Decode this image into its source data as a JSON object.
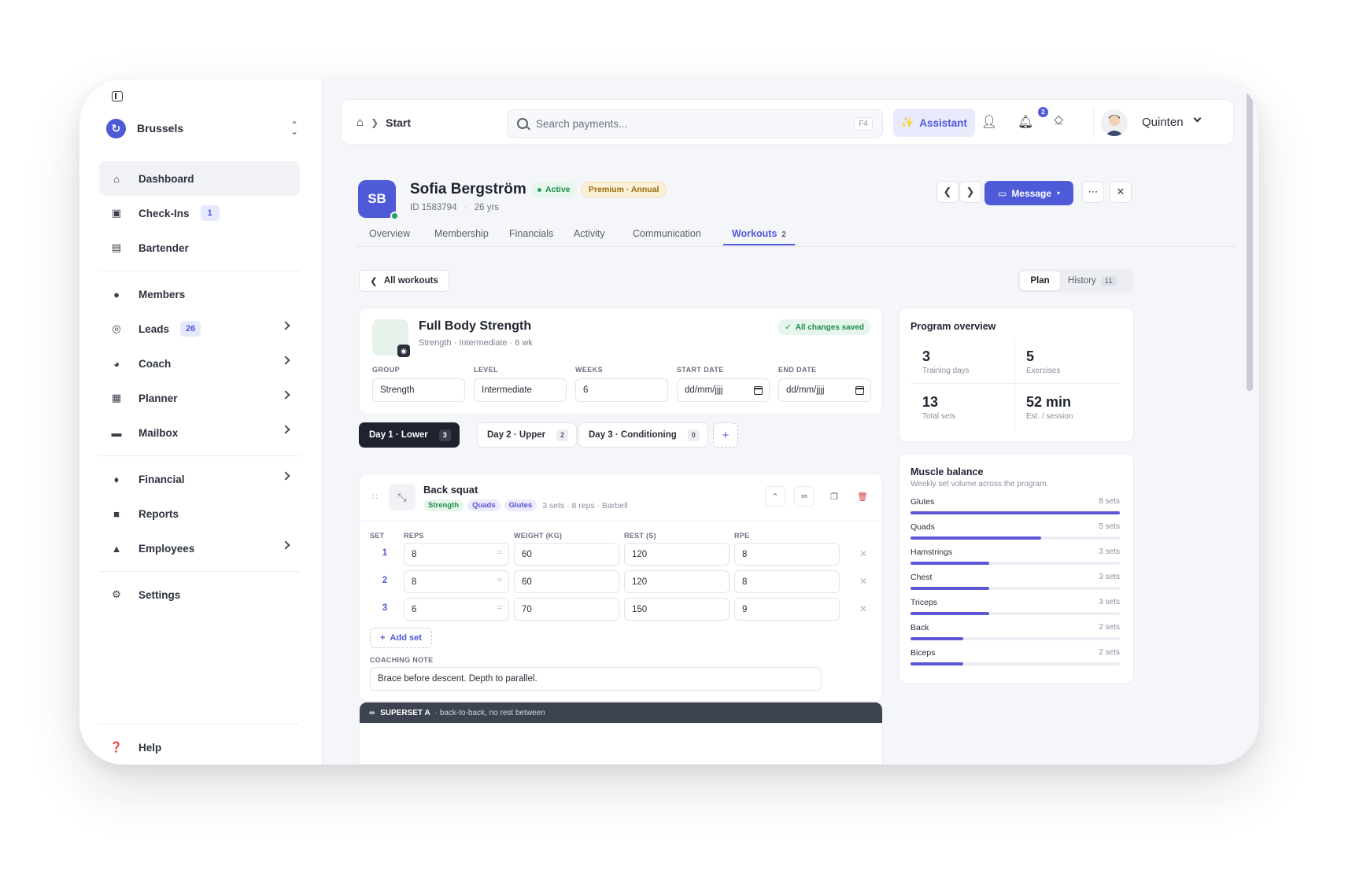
{
  "sidebar": {
    "org_name": "Brussels",
    "items": [
      {
        "label": "Dashboard",
        "icon": "home-icon"
      },
      {
        "label": "Check-Ins",
        "icon": "checkin-icon",
        "badge": "1"
      },
      {
        "label": "Bartender",
        "icon": "bartender-icon"
      },
      {
        "label": "Members",
        "icon": "members-icon"
      },
      {
        "label": "Leads",
        "icon": "leads-icon",
        "badge": "26"
      },
      {
        "label": "Coach",
        "icon": "coach-icon"
      },
      {
        "label": "Planner",
        "icon": "planner-icon"
      },
      {
        "label": "Mailbox",
        "icon": "mailbox-icon"
      },
      {
        "label": "Financial",
        "icon": "financial-icon"
      },
      {
        "label": "Reports",
        "icon": "reports-icon"
      },
      {
        "label": "Employees",
        "icon": "employees-icon"
      },
      {
        "label": "Settings",
        "icon": "gear-icon"
      },
      {
        "label": "Help",
        "icon": "help-icon"
      }
    ]
  },
  "topbar": {
    "breadcrumb": "Start",
    "search_placeholder": "Search payments...",
    "search_shortcut": "F4",
    "assistant_label": "Assistant",
    "notification_count": "2",
    "user_name": "Quinten"
  },
  "member": {
    "initials": "SB",
    "name": "Sofia Bergström",
    "status": "Active",
    "plan": "Premium · Annual",
    "id_text": "ID 1583794",
    "age": "26 yrs",
    "message_label": "Message"
  },
  "tabs": [
    {
      "label": "Overview"
    },
    {
      "label": "Membership"
    },
    {
      "label": "Financials"
    },
    {
      "label": "Activity"
    },
    {
      "label": "Communication"
    },
    {
      "label": "Workouts",
      "count": "2"
    }
  ],
  "workouts": {
    "back_label": "All workouts",
    "plan_label": "Plan",
    "history_label": "History",
    "history_count": "11"
  },
  "program": {
    "title": "Full Body Strength",
    "subtitle": "Strength · Intermediate · 6 wk",
    "saved_label": "All changes saved",
    "fields": {
      "group_label": "GROUP",
      "group_value": "Strength",
      "level_label": "LEVEL",
      "level_value": "Intermediate",
      "weeks_label": "WEEKS",
      "weeks_value": "6",
      "start_label": "START DATE",
      "start_value": "dd/mm/jjjj",
      "end_label": "END DATE",
      "end_value": "dd/mm/jjjj"
    }
  },
  "days": [
    {
      "label": "Day 1 · Lower",
      "count": "3"
    },
    {
      "label": "Day 2 · Upper",
      "count": "2"
    },
    {
      "label": "Day 3 · Conditioning",
      "count": "0"
    }
  ],
  "exercise": {
    "name": "Back squat",
    "tags": [
      "Strength",
      "Quads",
      "Glutes"
    ],
    "meta": "3 sets · 8 reps · Barbell",
    "headers": {
      "set": "SET",
      "reps": "REPS",
      "weight": "WEIGHT (KG)",
      "rest": "REST (S)",
      "rpe": "RPE"
    },
    "sets": [
      {
        "n": "1",
        "reps": "8",
        "weight": "60",
        "rest": "120",
        "rpe": "8"
      },
      {
        "n": "2",
        "reps": "8",
        "weight": "60",
        "rest": "120",
        "rpe": "8"
      },
      {
        "n": "3",
        "reps": "6",
        "weight": "70",
        "rest": "150",
        "rpe": "9"
      }
    ],
    "add_set_label": "Add set",
    "note_label": "COACHING NOTE",
    "note_value": "Brace before descent. Depth to parallel."
  },
  "superset": {
    "title": "SUPERSET A",
    "subtitle": "· back-to-back, no rest between"
  },
  "overview": {
    "title": "Program overview",
    "stats": [
      {
        "value": "3",
        "label": "Training days"
      },
      {
        "value": "5",
        "label": "Exercises"
      },
      {
        "value": "13",
        "label": "Total sets"
      },
      {
        "value": "52 min",
        "label": "Est. / session"
      }
    ]
  },
  "muscle_balance": {
    "title": "Muscle balance",
    "subtitle": "Weekly set volume across the program.",
    "max_sets": 8,
    "rows": [
      {
        "name": "Glutes",
        "label": "8 sets",
        "sets": 8
      },
      {
        "name": "Quads",
        "label": "5 sets",
        "sets": 5
      },
      {
        "name": "Hamstrings",
        "label": "3 sets",
        "sets": 3
      },
      {
        "name": "Chest",
        "label": "3 sets",
        "sets": 3
      },
      {
        "name": "Triceps",
        "label": "3 sets",
        "sets": 3
      },
      {
        "name": "Back",
        "label": "2 sets",
        "sets": 2
      },
      {
        "name": "Biceps",
        "label": "2 sets",
        "sets": 2
      }
    ]
  },
  "colors": {
    "accent": "#4f5ad8",
    "success": "#23a35a",
    "dark": "#1f2330"
  }
}
